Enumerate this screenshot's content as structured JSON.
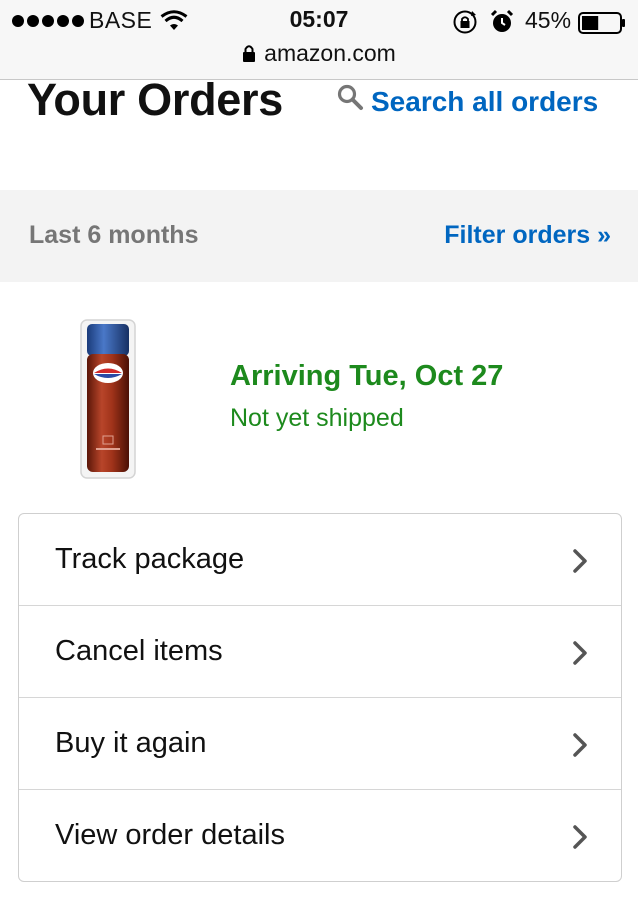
{
  "status_bar": {
    "carrier": "BASE",
    "time": "05:07",
    "battery_percent": "45%",
    "battery_level": 0.45,
    "url": "amazon.com"
  },
  "header": {
    "title": "Your Orders",
    "search_label": "Search all orders"
  },
  "filter": {
    "range": "Last 6 months",
    "filter_label": "Filter orders »"
  },
  "order": {
    "arrival": "Arriving Tue, Oct 27",
    "status": "Not yet shipped"
  },
  "actions": [
    {
      "label": "Track package"
    },
    {
      "label": "Cancel items"
    },
    {
      "label": "Buy it again"
    },
    {
      "label": "View order details"
    }
  ],
  "colors": {
    "link": "#0066c0",
    "success": "#1d8a1d",
    "band": "#f3f3f3"
  },
  "icons": {
    "search": "search-icon",
    "chevron": "chevron-right-icon"
  }
}
